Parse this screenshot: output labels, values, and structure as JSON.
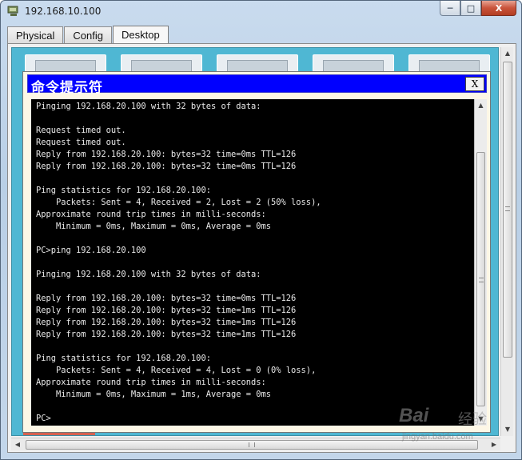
{
  "window": {
    "title": "192.168.10.100",
    "minimize_glyph": "─",
    "maximize_glyph": "□",
    "close_glyph": "X"
  },
  "tabs": [
    {
      "label": "Physical",
      "active": false
    },
    {
      "label": "Config",
      "active": false
    },
    {
      "label": "Desktop",
      "active": true
    }
  ],
  "cmd": {
    "title": "命令提示符",
    "close_label": "X",
    "lines": [
      "Pinging 192.168.20.100 with 32 bytes of data:",
      "",
      "Request timed out.",
      "Request timed out.",
      "Reply from 192.168.20.100: bytes=32 time=0ms TTL=126",
      "Reply from 192.168.20.100: bytes=32 time=0ms TTL=126",
      "",
      "Ping statistics for 192.168.20.100:",
      "    Packets: Sent = 4, Received = 2, Lost = 2 (50% loss),",
      "Approximate round trip times in milli-seconds:",
      "    Minimum = 0ms, Maximum = 0ms, Average = 0ms",
      "",
      "PC>ping 192.168.20.100",
      "",
      "Pinging 192.168.20.100 with 32 bytes of data:",
      "",
      "Reply from 192.168.20.100: bytes=32 time=0ms TTL=126",
      "Reply from 192.168.20.100: bytes=32 time=1ms TTL=126",
      "Reply from 192.168.20.100: bytes=32 time=1ms TTL=126",
      "Reply from 192.168.20.100: bytes=32 time=1ms TTL=126",
      "",
      "Ping statistics for 192.168.20.100:",
      "    Packets: Sent = 4, Received = 4, Lost = 0 (0% loss),",
      "Approximate round trip times in milli-seconds:",
      "    Minimum = 0ms, Maximum = 1ms, Average = 0ms",
      "",
      "PC>"
    ]
  },
  "watermark": {
    "brand": "Bai",
    "brand_suffix": "经验",
    "url": "jingyan.baidu.com"
  },
  "colors": {
    "cmd_title_bg": "#0000ff",
    "desktop_bg": "#4fb7d3",
    "terminal_bg": "#000000",
    "terminal_fg": "#eaeaea"
  },
  "icons": {
    "app_icon": "packet-tracer-pc-icon",
    "scroll_up": "arrow-up-icon",
    "scroll_down": "arrow-down-icon",
    "scroll_left": "arrow-left-icon",
    "scroll_right": "arrow-right-icon"
  }
}
